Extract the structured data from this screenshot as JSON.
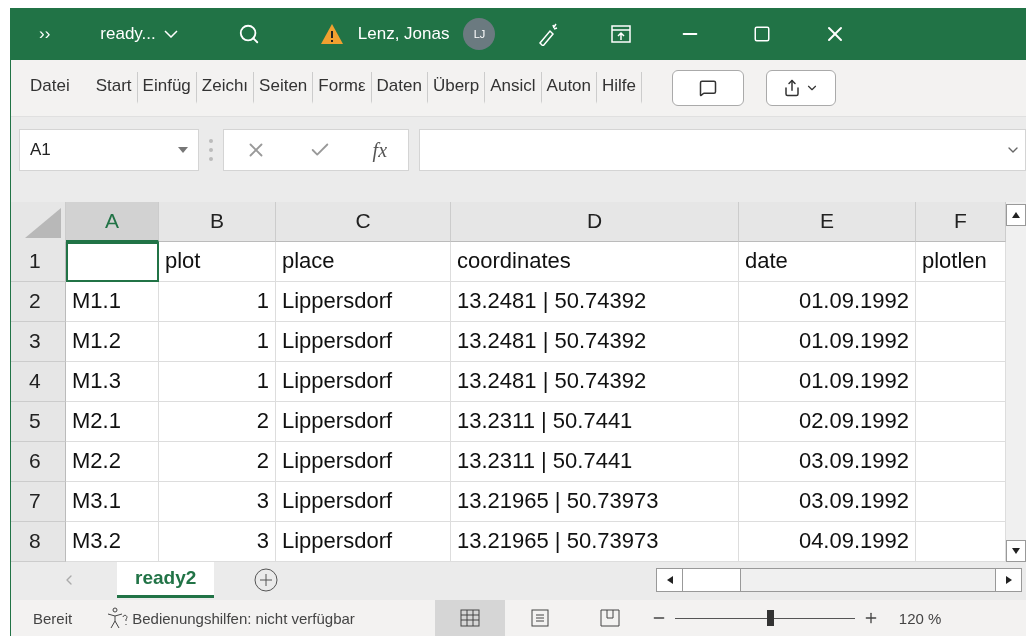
{
  "window": {
    "more": "››",
    "file": "ready...",
    "user": "Lenz, Jonas",
    "avatar": "LJ"
  },
  "ribbon_tabs": [
    {
      "label": "Datei",
      "selected": false
    },
    {
      "label": "Start",
      "selected": false
    },
    {
      "label": "Einfüg",
      "selected": false
    },
    {
      "label": "Zeichı",
      "selected": false
    },
    {
      "label": "Seiten",
      "selected": false
    },
    {
      "label": "Formε",
      "selected": false
    },
    {
      "label": "Daten",
      "selected": false
    },
    {
      "label": "Überp",
      "selected": false
    },
    {
      "label": "Ansicl",
      "selected": false
    },
    {
      "label": "Auton",
      "selected": false
    },
    {
      "label": "Hilfe",
      "selected": false
    }
  ],
  "formula_bar": {
    "name_box": "A1",
    "fx": "fx"
  },
  "columns": [
    {
      "label": "A",
      "selected": true
    },
    {
      "label": "B",
      "selected": false
    },
    {
      "label": "C",
      "selected": false
    },
    {
      "label": "D",
      "selected": false
    },
    {
      "label": "E",
      "selected": false
    },
    {
      "label": "F",
      "selected": false
    }
  ],
  "rows": [
    {
      "header": "1",
      "cells": [
        null,
        {
          "v": "plot",
          "kind": "text"
        },
        {
          "v": "place",
          "kind": "text"
        },
        {
          "v": "coordinates",
          "kind": "text"
        },
        {
          "v": "date",
          "kind": "text"
        },
        {
          "v": "plotlen",
          "kind": "text"
        }
      ]
    },
    {
      "header": "2",
      "cells": [
        {
          "v": "M1.1",
          "kind": "text"
        },
        {
          "v": "1",
          "kind": "number"
        },
        {
          "v": "Lippersdorf",
          "kind": "text"
        },
        {
          "v": "13.2481 | 50.74392",
          "kind": "text"
        },
        {
          "v": "01.09.1992",
          "kind": "number"
        },
        null
      ]
    },
    {
      "header": "3",
      "cells": [
        {
          "v": "M1.2",
          "kind": "text"
        },
        {
          "v": "1",
          "kind": "number"
        },
        {
          "v": "Lippersdorf",
          "kind": "text"
        },
        {
          "v": "13.2481 | 50.74392",
          "kind": "text"
        },
        {
          "v": "01.09.1992",
          "kind": "number"
        },
        null
      ]
    },
    {
      "header": "4",
      "cells": [
        {
          "v": "M1.3",
          "kind": "text"
        },
        {
          "v": "1",
          "kind": "number"
        },
        {
          "v": "Lippersdorf",
          "kind": "text"
        },
        {
          "v": "13.2481 | 50.74392",
          "kind": "text"
        },
        {
          "v": "01.09.1992",
          "kind": "number"
        },
        null
      ]
    },
    {
      "header": "5",
      "cells": [
        {
          "v": "M2.1",
          "kind": "text"
        },
        {
          "v": "2",
          "kind": "number"
        },
        {
          "v": "Lippersdorf",
          "kind": "text"
        },
        {
          "v": "13.2311 | 50.7441",
          "kind": "text"
        },
        {
          "v": "02.09.1992",
          "kind": "number"
        },
        null
      ]
    },
    {
      "header": "6",
      "cells": [
        {
          "v": "M2.2",
          "kind": "text"
        },
        {
          "v": "2",
          "kind": "number"
        },
        {
          "v": "Lippersdorf",
          "kind": "text"
        },
        {
          "v": "13.2311 | 50.7441",
          "kind": "text"
        },
        {
          "v": "03.09.1992",
          "kind": "number"
        },
        null
      ]
    },
    {
      "header": "7",
      "cells": [
        {
          "v": "M3.1",
          "kind": "text"
        },
        {
          "v": "3",
          "kind": "number"
        },
        {
          "v": "Lippersdorf",
          "kind": "text"
        },
        {
          "v": "13.21965 | 50.73973",
          "kind": "text"
        },
        {
          "v": "03.09.1992",
          "kind": "number"
        },
        null
      ]
    },
    {
      "header": "8",
      "cells": [
        {
          "v": "M3.2",
          "kind": "text"
        },
        {
          "v": "3",
          "kind": "number"
        },
        {
          "v": "Lippersdorf",
          "kind": "text"
        },
        {
          "v": "13.21965 | 50.73973",
          "kind": "text"
        },
        {
          "v": "04.09.1992",
          "kind": "number"
        },
        null
      ]
    }
  ],
  "sheet_tabs": [
    {
      "label": "ready2",
      "selected": true
    }
  ],
  "status_bar": {
    "ready": "Bereit",
    "accessibility": "Bedienungshilfen: nicht verfügbar",
    "views": [
      {
        "kind": "normal",
        "selected": true
      },
      {
        "kind": "page",
        "selected": false
      },
      {
        "kind": "break",
        "selected": false
      }
    ],
    "zoom": {
      "level": 0.53,
      "reading": "120 %"
    }
  }
}
